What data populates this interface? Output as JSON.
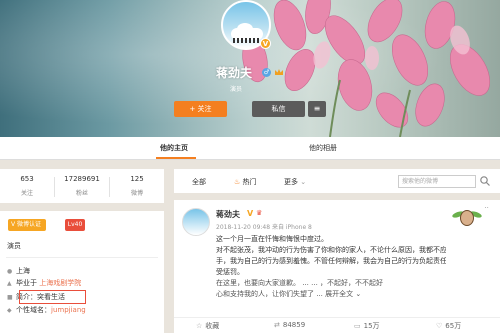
{
  "profile": {
    "name": "蒋劲夫",
    "subtitle": "演员",
    "verified_mark": "V",
    "gender_mark": "♂",
    "follow_label": "+ 关注",
    "message_label": "私信",
    "more_label": "≡"
  },
  "tabs": [
    {
      "label": "他的主页",
      "active": true
    },
    {
      "label": "他的相册",
      "active": false
    }
  ],
  "stats": [
    {
      "value": "653",
      "label": "关注"
    },
    {
      "value": "17289691",
      "label": "粉丝"
    },
    {
      "value": "125",
      "label": "微博"
    }
  ],
  "info": {
    "verify_badge": "V 微博认证",
    "level_badge": "Lv40",
    "role": "演员",
    "rows": [
      {
        "icon": "location-icon",
        "text": "上海",
        "link": ""
      },
      {
        "icon": "school-icon",
        "text": "毕业于 ",
        "link": "上海戏剧学院"
      },
      {
        "icon": "intro-icon",
        "text": "简介：",
        "link": "",
        "extra": "突看生活"
      },
      {
        "icon": "domain-icon",
        "text": "个性域名：",
        "link": "jumpjiang"
      }
    ]
  },
  "filter": {
    "all": "全部",
    "hot": "热门",
    "more": "更多",
    "search_placeholder": "搜索他的微博"
  },
  "post": {
    "author": "蒋劲夫",
    "meta": "2018-11-20 09:48 来自 iPhone 8",
    "collapse": "∨",
    "lines": [
      "这一个月一直在忏悔和悔恨中度过。",
      "对不起张茂，我冲动的行为伤害了你和你的家人，不论什么原因，我都不应该动",
      "手，我为自己的行为感到羞愧。不管任何辩解，我会为自己的行为负起责任，接",
      "受惩罚。",
      "在这里，也要向大家道歉。 ... ... ，不起好，不不起好",
      "心和支持我的人，让你们失望了 ... 展开全文 ⌄"
    ],
    "actions": [
      {
        "icon": "collect-icon",
        "label": "收藏"
      },
      {
        "icon": "repost-icon",
        "label": "84859"
      },
      {
        "icon": "comment-icon",
        "label": "15万"
      },
      {
        "icon": "like-icon",
        "label": "65万"
      }
    ]
  },
  "colors": {
    "accent": "#f47f20",
    "dark_button": "#5b5b5b",
    "badge_orange": "#f6a623",
    "badge_red": "#e94e3b",
    "link": "#eb7350"
  }
}
